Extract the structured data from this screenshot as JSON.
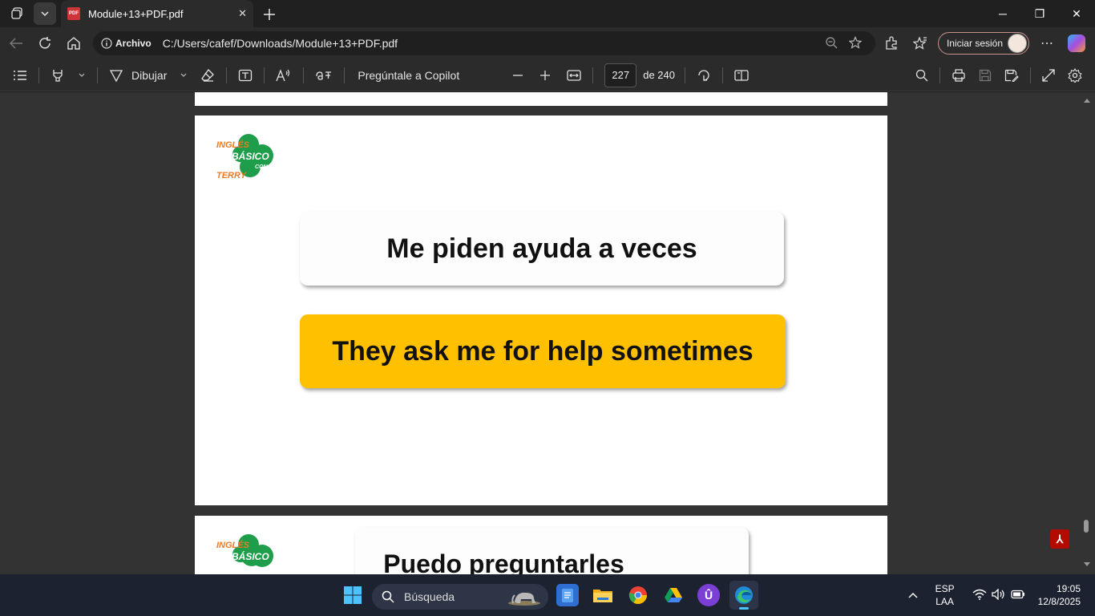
{
  "browser": {
    "tab_title": "Module+13+PDF.pdf",
    "tab_icon_label": "PDF",
    "address_info": "Archivo",
    "url": "C:/Users/cafef/Downloads/Module+13+PDF.pdf",
    "signin_label": "Iniciar sesión"
  },
  "pdf_toolbar": {
    "draw_label": "Dibujar",
    "ask_copilot_label": "Pregúntale a Copilot",
    "current_page": "227",
    "total_pages_label": "de 240"
  },
  "document": {
    "logo_text_top": "INGLÉS",
    "logo_text_mid": "BÁSICO",
    "logo_text_con": "CON",
    "logo_text_bottom": "TERRY",
    "spanish_phrase": "Me piden ayuda a veces",
    "english_phrase": "They ask me for help sometimes",
    "next_page_phrase": "Puedo preguntarles",
    "card_yellow_color": "#ffc000",
    "logo_green_color": "#1e9e4a",
    "logo_orange_color": "#f07a24"
  },
  "taskbar": {
    "search_placeholder": "Búsqueda",
    "language_line1": "ESP",
    "language_line2": "LAA",
    "time": "19:05",
    "date": "12/8/2025"
  }
}
